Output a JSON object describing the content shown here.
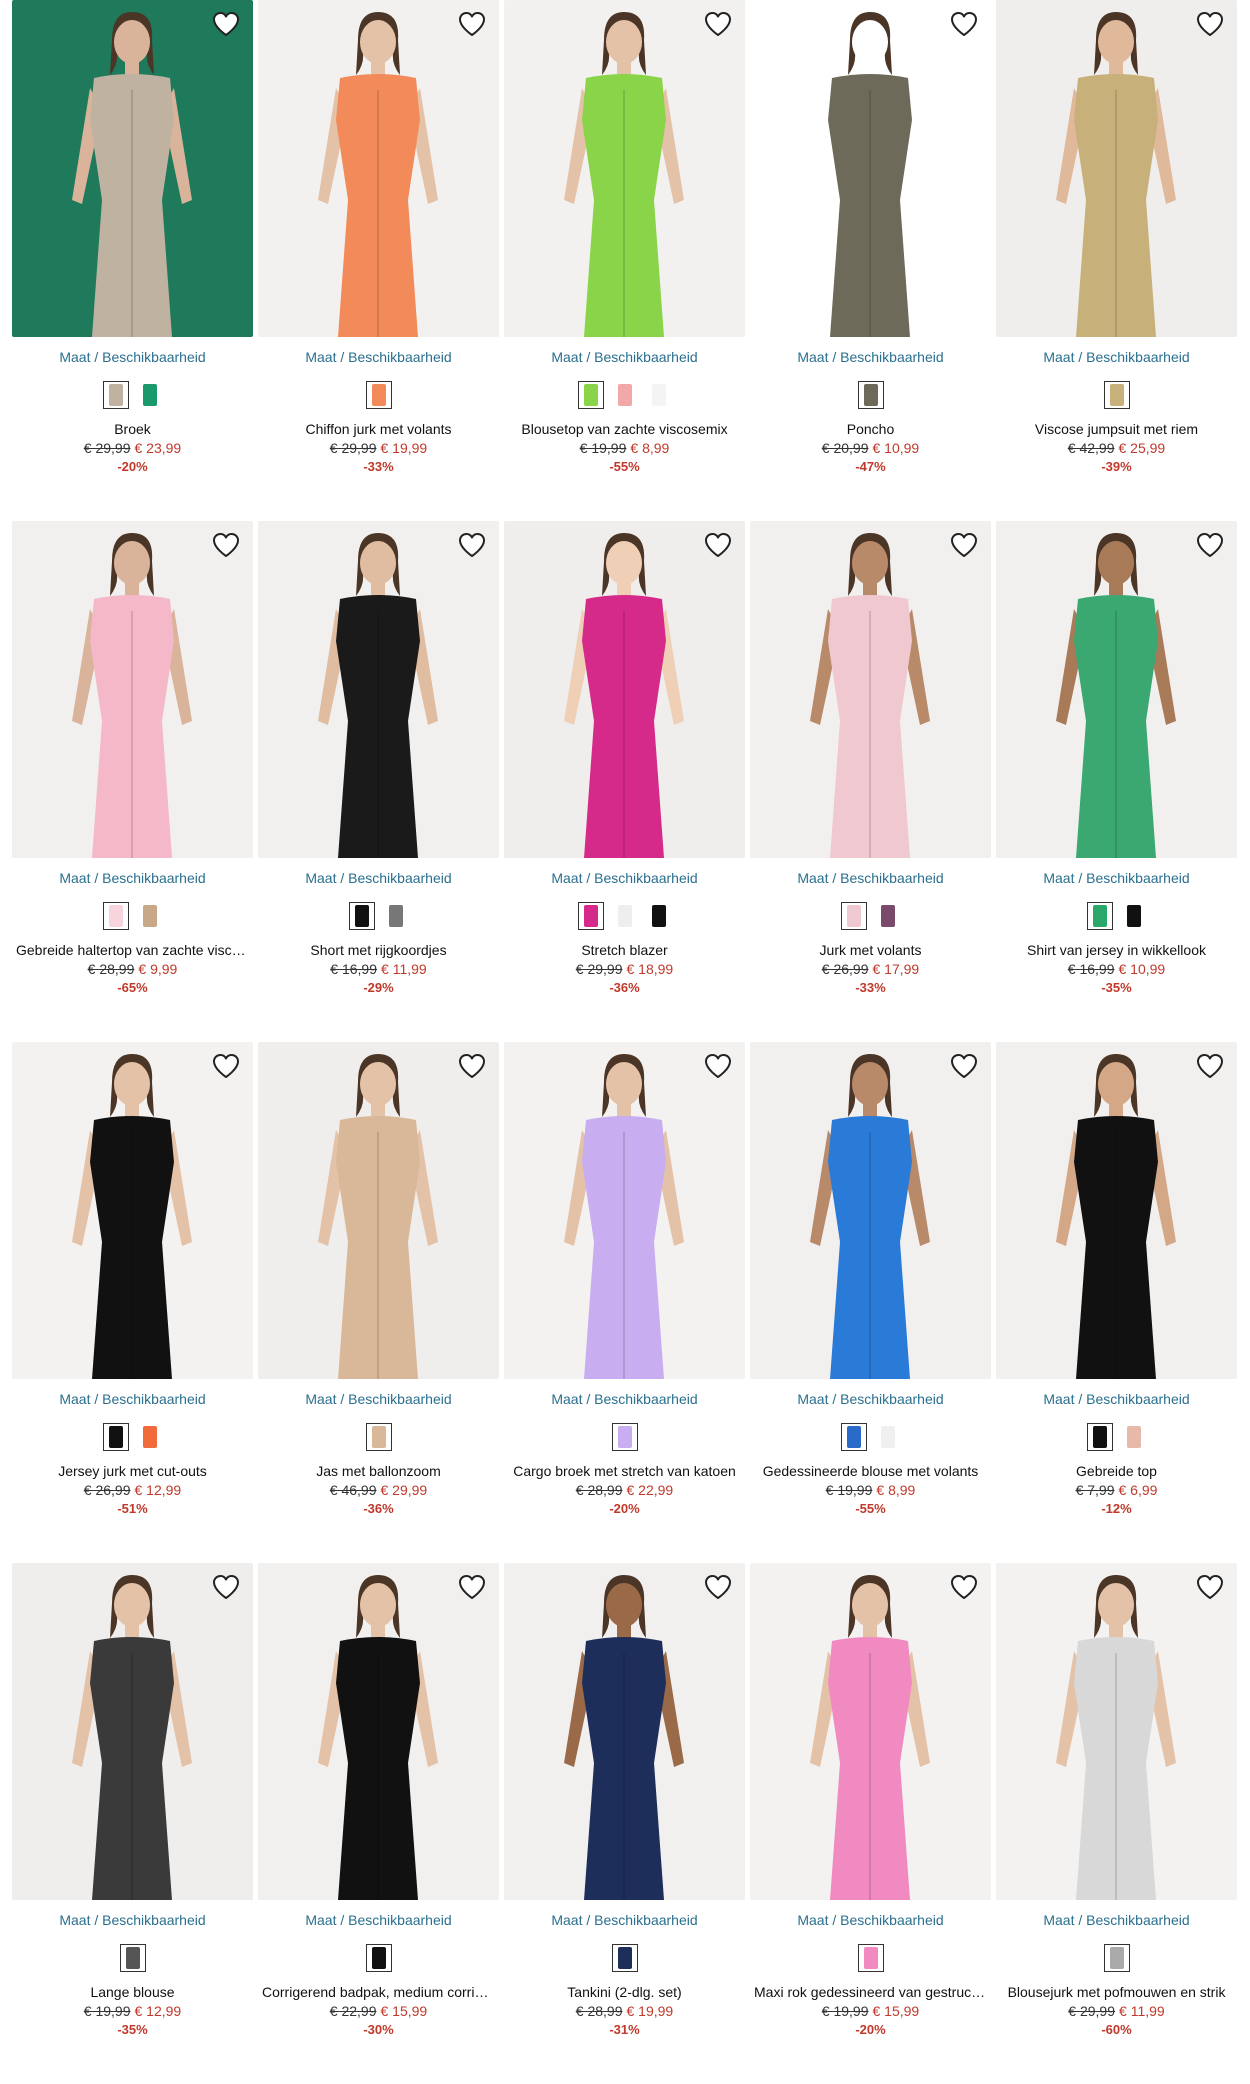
{
  "size_label": "Maat / Beschikbaarheid",
  "icons": {
    "wishlist": "heart-outline-icon"
  },
  "colors": {
    "link": "#2a6f8f",
    "sale": "#c0392b"
  },
  "products": [
    {
      "title": "Broek",
      "old_price": "€ 29,99",
      "new_price": "€ 23,99",
      "discount": "-20%",
      "bg": "#1e7a5a",
      "garment": "#bfb2a0",
      "skin": "#d9b49a",
      "swatches": [
        "#bfb2a0",
        "#1a9a6a"
      ]
    },
    {
      "title": "Chiffon jurk met volants",
      "old_price": "€ 29,99",
      "new_price": "€ 19,99",
      "discount": "-33%",
      "bg": "#f3f1ef",
      "garment": "#f28a5a",
      "skin": "#e4c2a8",
      "swatches": [
        "#f28a5a"
      ]
    },
    {
      "title": "Blousetop van zachte viscosemix",
      "old_price": "€ 19,99",
      "new_price": "€ 8,99",
      "discount": "-55%",
      "bg": "#f3f1ef",
      "garment": "#8ad44a",
      "skin": "#e4c2a8",
      "swatches": [
        "#8ad44a",
        "#f2a8a8",
        "#f4f4f4"
      ]
    },
    {
      "title": "Poncho",
      "old_price": "€ 20,99",
      "new_price": "€ 10,99",
      "discount": "-47%",
      "bg": "#ffffff",
      "garment": "#6e6a5a",
      "skin": "#ffffff",
      "swatches": [
        "#6e6a5a"
      ]
    },
    {
      "title": "Viscose jumpsuit met riem",
      "old_price": "€ 42,99",
      "new_price": "€ 25,99",
      "discount": "-39%",
      "bg": "#f0eeec",
      "garment": "#c8b07a",
      "skin": "#e0b89a",
      "swatches": [
        "#c8b07a"
      ]
    },
    {
      "title": "Gebreide haltertop van zachte viscose",
      "old_price": "€ 28,99",
      "new_price": "€ 9,99",
      "discount": "-65%",
      "bg": "#f2f0ee",
      "garment": "#f4b8c8",
      "skin": "#d9b49a",
      "swatches": [
        "#f8d4dc",
        "#c8a888"
      ]
    },
    {
      "title": "Short met rijgkoordjes",
      "old_price": "€ 16,99",
      "new_price": "€ 11,99",
      "discount": "-29%",
      "bg": "#f2f0ee",
      "garment": "#1a1a1a",
      "skin": "#e0bda0",
      "swatches": [
        "#111111",
        "#777777"
      ]
    },
    {
      "title": "Stretch blazer",
      "old_price": "€ 29,99",
      "new_price": "€ 18,99",
      "discount": "-36%",
      "bg": "#f0eeec",
      "garment": "#d62a8a",
      "skin": "#efcfb5",
      "swatches": [
        "#d62a8a",
        "#eeeeee",
        "#111111"
      ]
    },
    {
      "title": "Jurk met volants",
      "old_price": "€ 26,99",
      "new_price": "€ 17,99",
      "discount": "-33%",
      "bg": "#f2f0ee",
      "garment": "#f0c8d0",
      "skin": "#b88a6a",
      "swatches": [
        "#f0c8d0",
        "#7a4a6a"
      ]
    },
    {
      "title": "Shirt van jersey in wikkellook",
      "old_price": "€ 16,99",
      "new_price": "€ 10,99",
      "discount": "-35%",
      "bg": "#f2f0ee",
      "garment": "#3aa870",
      "skin": "#a87a58",
      "swatches": [
        "#2aa86a",
        "#111111"
      ]
    },
    {
      "title": "Jersey jurk met cut-outs",
      "old_price": "€ 26,99",
      "new_price": "€ 12,99",
      "discount": "-51%",
      "bg": "#f3f2f0",
      "garment": "#111111",
      "skin": "#e4c2a8",
      "swatches": [
        "#111111",
        "#f06a3a"
      ]
    },
    {
      "title": "Jas met ballonzoom",
      "old_price": "€ 46,99",
      "new_price": "€ 29,99",
      "discount": "-36%",
      "bg": "#f0eeec",
      "garment": "#d8b898",
      "skin": "#e4c2a8",
      "swatches": [
        "#d8b898"
      ]
    },
    {
      "title": "Cargo broek met stretch van katoen",
      "old_price": "€ 28,99",
      "new_price": "€ 22,99",
      "discount": "-20%",
      "bg": "#f3f2f0",
      "garment": "#c8aef0",
      "skin": "#e4c2a8",
      "swatches": [
        "#c8aef0"
      ]
    },
    {
      "title": "Gedessineerde blouse met volants",
      "old_price": "€ 19,99",
      "new_price": "€ 8,99",
      "discount": "-55%",
      "bg": "#f2f0ee",
      "garment": "#2a7ad8",
      "skin": "#b88a6a",
      "swatches": [
        "#2a6ac8",
        "#f0f0f0"
      ]
    },
    {
      "title": "Gebreide top",
      "old_price": "€ 7,99",
      "new_price": "€ 6,99",
      "discount": "-12%",
      "bg": "#f2f0ee",
      "garment": "#111111",
      "skin": "#d4a886",
      "swatches": [
        "#111111",
        "#e8b8a8"
      ]
    },
    {
      "title": "Lange blouse",
      "old_price": "€ 19,99",
      "new_price": "€ 12,99",
      "discount": "-35%",
      "bg": "#f0eeec",
      "garment": "#3a3a3a",
      "skin": "#e4c2a8",
      "swatches": [
        "#555555"
      ]
    },
    {
      "title": "Corrigerend badpak, medium corrigerend",
      "old_price": "€ 22,99",
      "new_price": "€ 15,99",
      "discount": "-30%",
      "bg": "#f2f0ee",
      "garment": "#111111",
      "skin": "#e4c2a8",
      "swatches": [
        "#111111"
      ]
    },
    {
      "title": "Tankini (2-dlg. set)",
      "old_price": "€ 28,99",
      "new_price": "€ 19,99",
      "discount": "-31%",
      "bg": "#f2f0ee",
      "garment": "#1e2e5a",
      "skin": "#9a6a48",
      "swatches": [
        "#1e2e5a"
      ]
    },
    {
      "title": "Maxi rok gedessineerd van gestructureerd",
      "old_price": "€ 19,99",
      "new_price": "€ 15,99",
      "discount": "-20%",
      "bg": "#f3f2f0",
      "garment": "#f08ac0",
      "skin": "#e4c2a8",
      "swatches": [
        "#f08ac0"
      ]
    },
    {
      "title": "Blousejurk met pofmouwen en strik",
      "old_price": "€ 29,99",
      "new_price": "€ 11,99",
      "discount": "-60%",
      "bg": "#f3f2f0",
      "garment": "#d8d8d8",
      "skin": "#e4c2a8",
      "swatches": [
        "#aaaaaa"
      ]
    }
  ]
}
